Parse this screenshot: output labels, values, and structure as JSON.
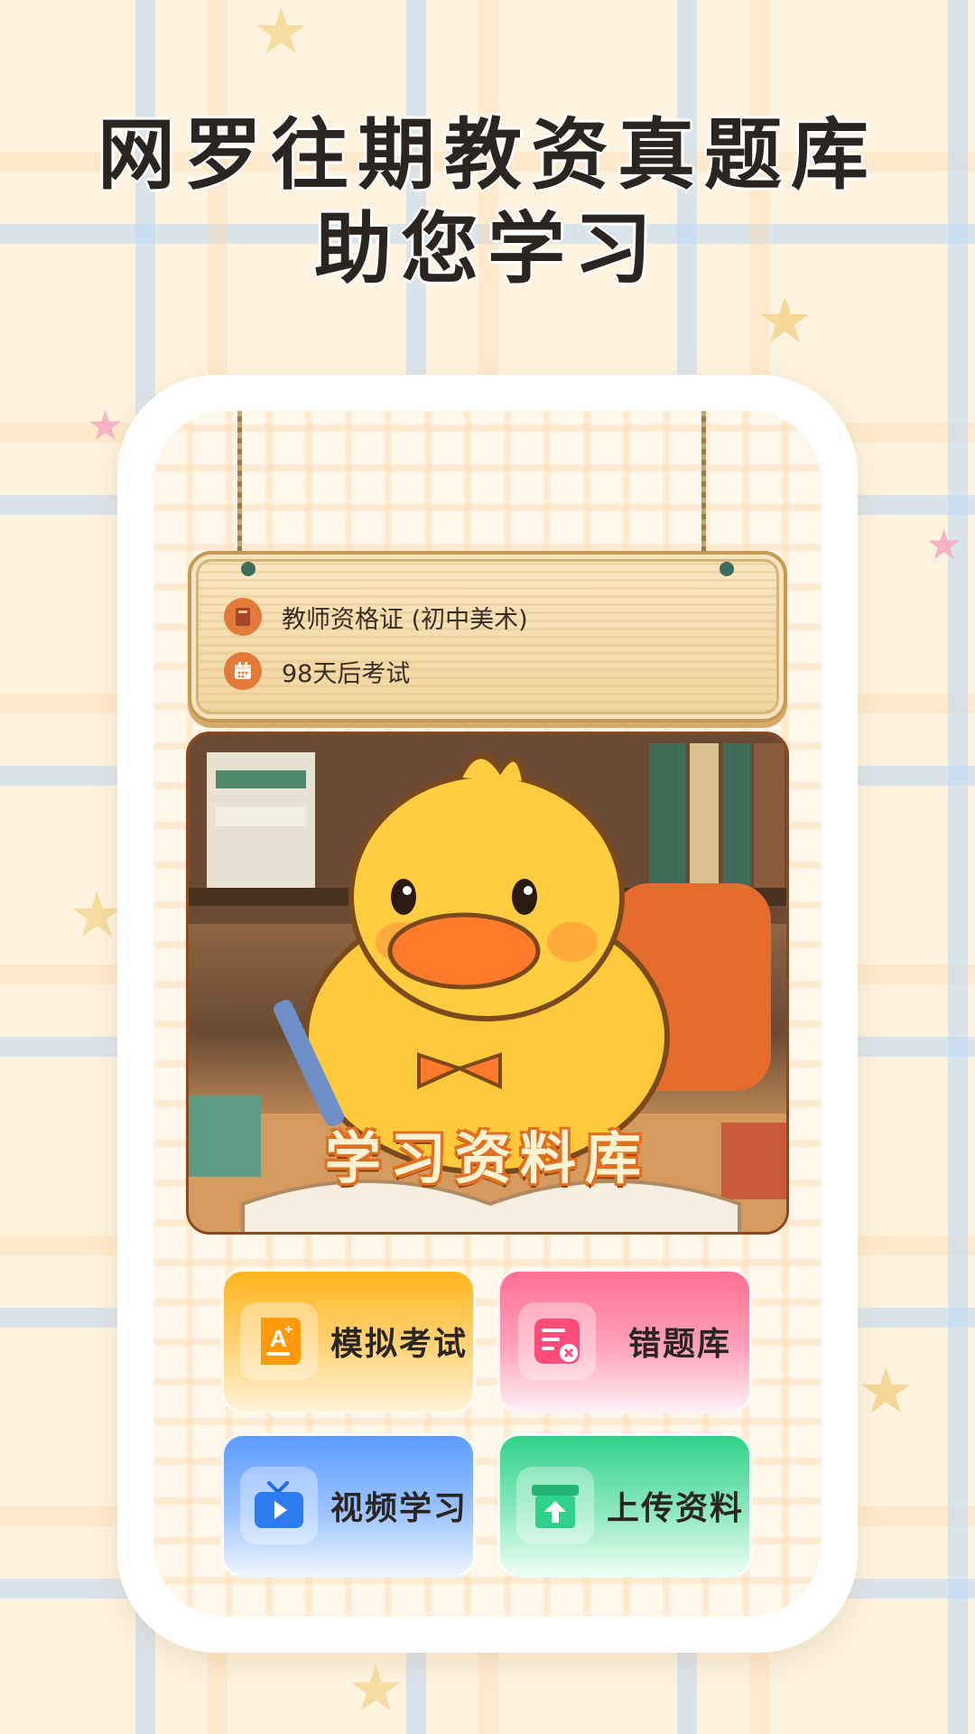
{
  "headline": {
    "line1": "网罗往期教资真题库",
    "line2": "助您学习"
  },
  "sign": {
    "exam_name": "教师资格证 (初中美术)",
    "countdown": "98天后考试",
    "book_icon": "book-icon",
    "calendar_icon": "calendar-icon"
  },
  "hero": {
    "title": "学习资料库"
  },
  "actions": [
    {
      "label": "模拟考试",
      "icon": "exam-icon",
      "color": "#ffb51e"
    },
    {
      "label": "错题库",
      "icon": "wrong-questions-icon",
      "color": "#ff6f92"
    },
    {
      "label": "视频学习",
      "icon": "tv-icon",
      "color": "#5b9cff"
    },
    {
      "label": "上传资料",
      "icon": "upload-icon",
      "color": "#2fd28a"
    }
  ]
}
